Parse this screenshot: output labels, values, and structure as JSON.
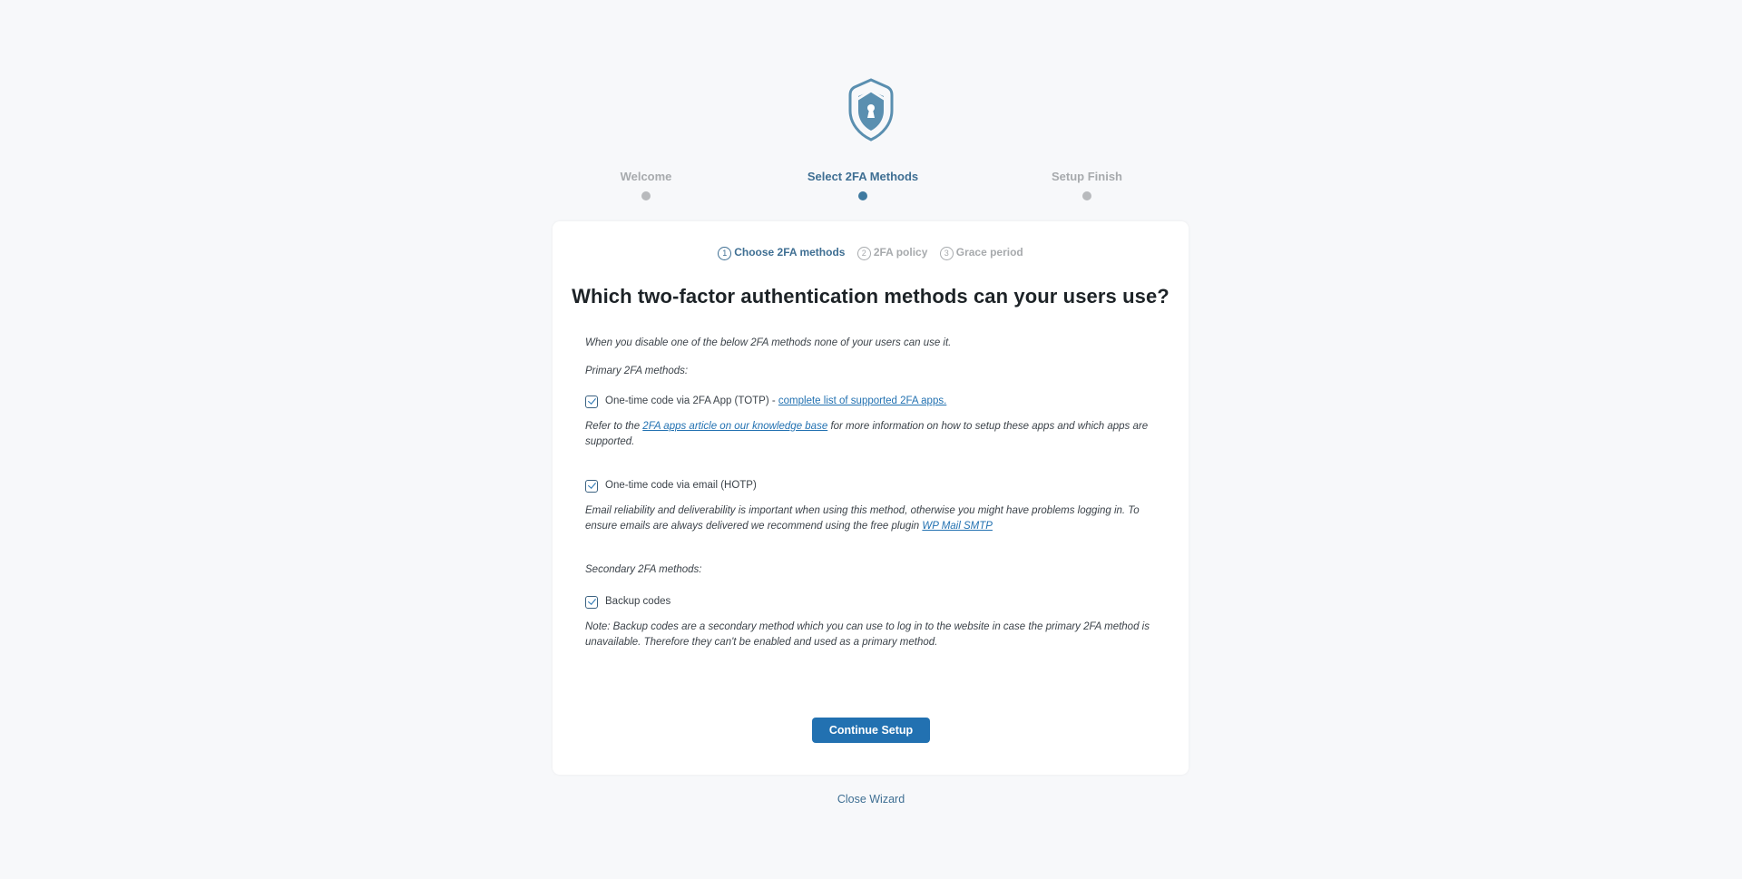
{
  "wizard_steps": [
    {
      "label": "Welcome",
      "active": false
    },
    {
      "label": "Select 2FA Methods",
      "active": true
    },
    {
      "label": "Setup Finish",
      "active": false
    }
  ],
  "substeps": [
    {
      "num": "1",
      "label": "Choose 2FA methods",
      "active": true
    },
    {
      "num": "2",
      "label": "2FA policy",
      "active": false
    },
    {
      "num": "3",
      "label": "Grace period",
      "active": false
    }
  ],
  "title": "Which two-factor authentication methods can your users use?",
  "intro": "When you disable one of the below 2FA methods none of your users can use it.",
  "primary_heading": "Primary 2FA methods:",
  "totp": {
    "checked": true,
    "label": "One-time code via 2FA App (TOTP) -",
    "link": "complete list of supported 2FA apps.",
    "note_prefix": "Refer to the",
    "note_link": "2FA apps article on our knowledge base",
    "note_suffix": "for more information on how to setup these apps and which apps are supported."
  },
  "hotp": {
    "checked": true,
    "label": "One-time code via email (HOTP)",
    "note": "Email reliability and deliverability is important when using this method, otherwise you might have problems logging in. To ensure emails are always delivered we recommend using the free plugin",
    "note_link": "WP Mail SMTP"
  },
  "secondary_heading": "Secondary 2FA methods:",
  "backup": {
    "checked": true,
    "label": "Backup codes",
    "note": "Note: Backup codes are a secondary method which you can use to log in to the website in case the primary 2FA method is unavailable. Therefore they can't be enabled and used as a primary method."
  },
  "continue_label": "Continue Setup",
  "close_label": "Close Wizard",
  "colors": {
    "accent": "#2271b1",
    "active_step": "#3f6f93",
    "inactive": "#a7aaad",
    "background": "#f7f8fa"
  }
}
